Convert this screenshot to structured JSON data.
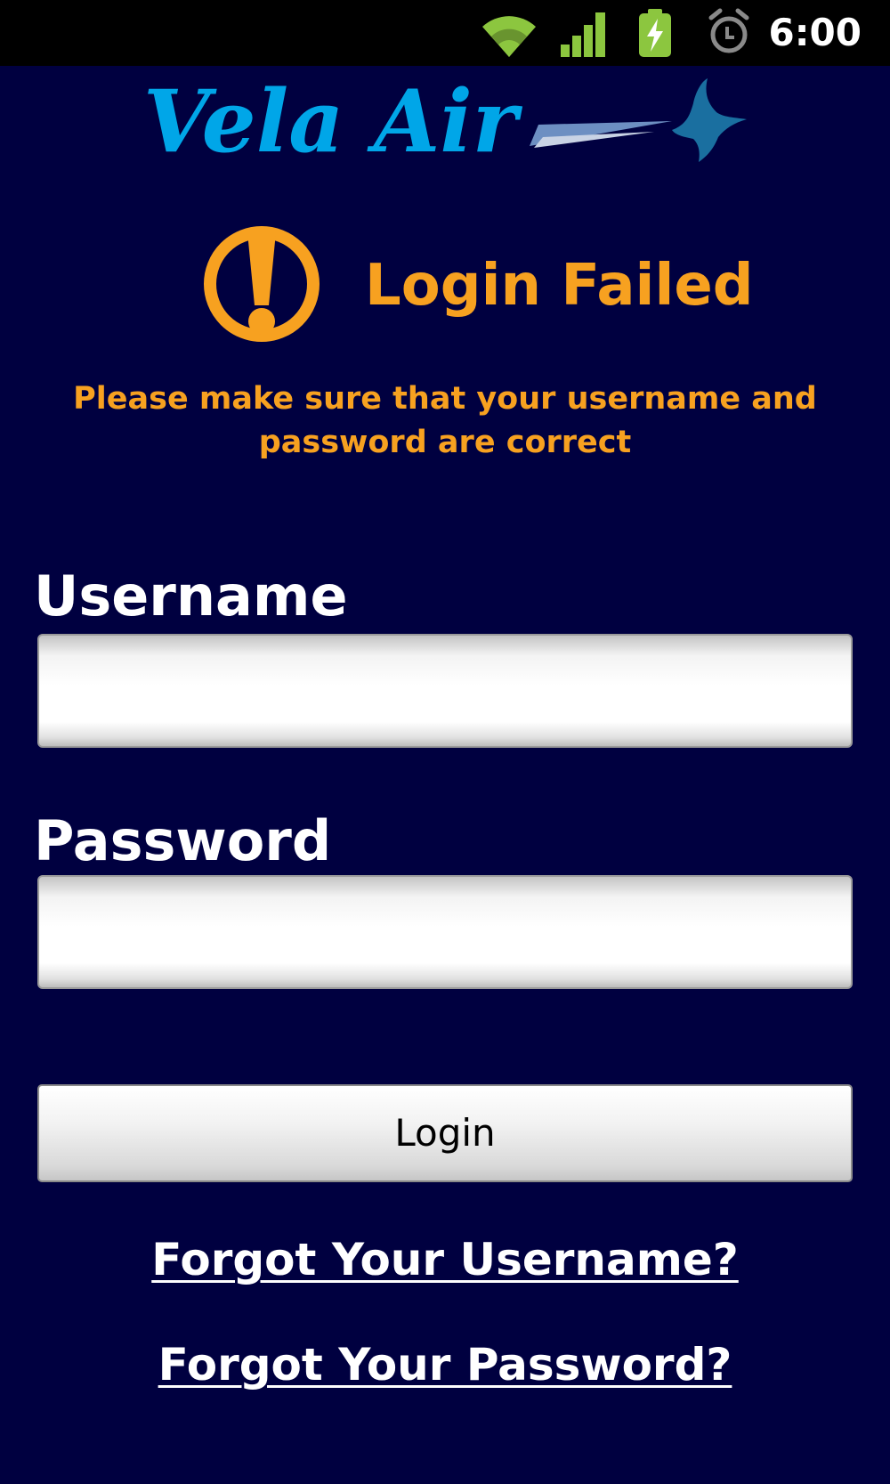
{
  "status_bar": {
    "time": "6:00",
    "icons": [
      "wifi-icon",
      "signal-icon",
      "battery-charging-icon",
      "alarm-icon"
    ],
    "icon_color": "#8CC63F"
  },
  "brand": {
    "logo_text": "Vela Air",
    "logo_color": "#00A6E8"
  },
  "alert": {
    "title": "Login Failed",
    "message": "Please make sure that your username and password are correct",
    "color": "#F7A120"
  },
  "form": {
    "username_label": "Username",
    "username_value": "",
    "password_label": "Password",
    "password_value": "",
    "login_label": "Login"
  },
  "links": {
    "forgot_username": "Forgot Your Username?",
    "forgot_password": "Forgot Your Password?"
  },
  "colors": {
    "background": "#000040",
    "text": "#FFFFFF"
  }
}
